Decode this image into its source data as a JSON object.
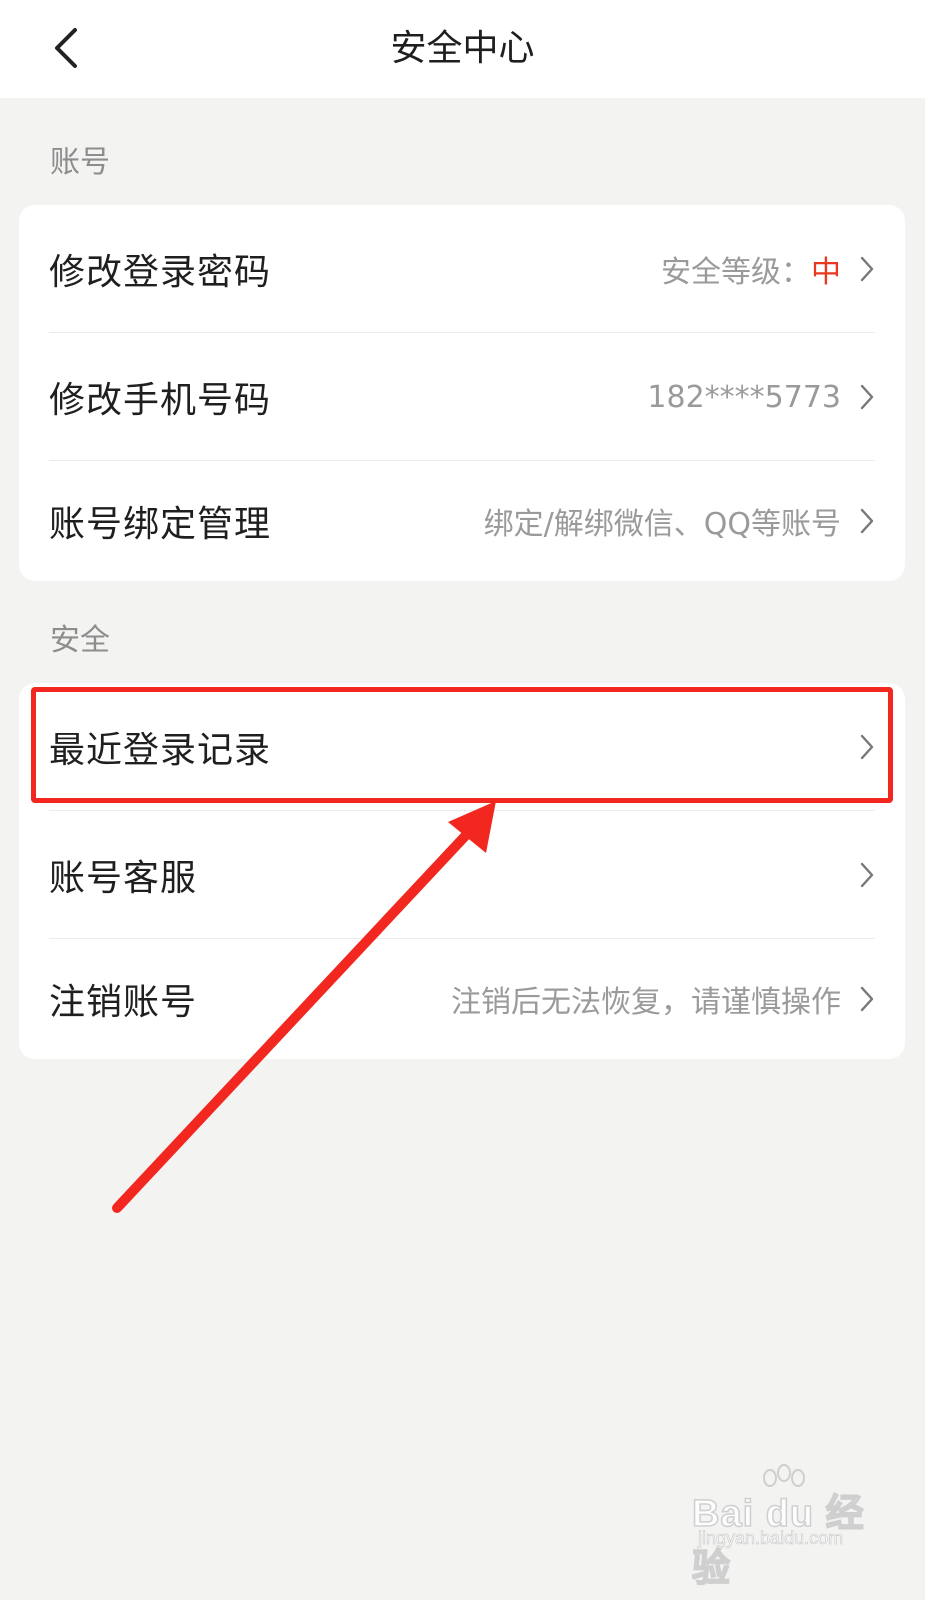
{
  "header": {
    "title": "安全中心",
    "back_icon": "chevron-left-icon"
  },
  "sections": [
    {
      "label": "账号",
      "items": [
        {
          "label": "修改登录密码",
          "value_prefix": "安全等级：",
          "value_level": "中",
          "level_color": "#e8391f"
        },
        {
          "label": "修改手机号码",
          "value": "182****5773"
        },
        {
          "label": "账号绑定管理",
          "value": "绑定/解绑微信、QQ等账号"
        }
      ]
    },
    {
      "label": "安全",
      "items": [
        {
          "label": "最近登录记录",
          "value": ""
        },
        {
          "label": "账号客服",
          "value": ""
        },
        {
          "label": "注销账号",
          "value": "注销后无法恢复，请谨慎操作"
        }
      ]
    }
  ],
  "annotation": {
    "highlight_color": "#f2271f",
    "highlighted_item": "最近登录记录"
  },
  "watermark": {
    "logo": "Bai du 经验",
    "url": "jingyan.baidu.com"
  }
}
